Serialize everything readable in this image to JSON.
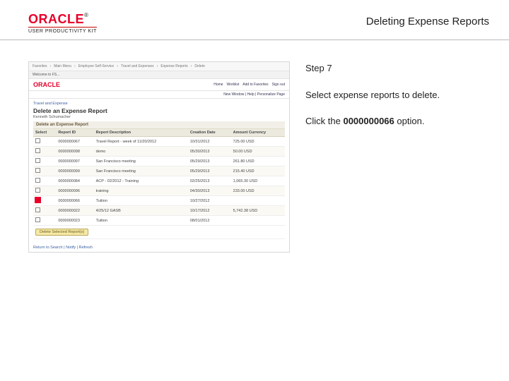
{
  "header": {
    "brand": "ORACLE",
    "tm": "®",
    "subbrand": "USER PRODUCTIVITY KIT",
    "doc_title": "Deleting Expense Reports"
  },
  "instructions": {
    "step_label": "Step 7",
    "line1": "Select expense reports to delete.",
    "line2a": "Click the ",
    "line2_bold": "0000000066",
    "line2b": " option."
  },
  "app": {
    "browser_tabs": [
      "Favorites",
      "Main Menu",
      "Employee Self-Service",
      "Travel and Expenses",
      "Expense Reports",
      "Delete"
    ],
    "tab_indicator": "Welcome to FS...",
    "brand": "ORACLE",
    "topnav": [
      "Home",
      "Worklist",
      "Add to Favorites",
      "Sign out"
    ],
    "userline": "New Window | Help | Personalize Page",
    "crumb": "Travel and Expense",
    "page_title": "Delete an Expense Report",
    "page_sub": "Kenneth Schumacher",
    "section": "Delete an Expense Report",
    "columns": [
      "Select",
      "Report ID",
      "Report Description",
      "Creation Date",
      "Amount Currency"
    ],
    "rows": [
      {
        "id": "0000000067",
        "desc": "Travel Report - week of 11/20/2012",
        "date": "10/31/2012",
        "amt": "725.00 USD"
      },
      {
        "id": "0000000098",
        "desc": "demo",
        "date": "05/30/2013",
        "amt": "50.00 USD"
      },
      {
        "id": "0000000097",
        "desc": "San Francisco meeting",
        "date": "05/29/2013",
        "amt": "261.80 USD"
      },
      {
        "id": "0000000099",
        "desc": "San Francisco meeting",
        "date": "05/29/2013",
        "amt": "215.40 USD"
      },
      {
        "id": "0000000084",
        "desc": "ACP - 02/2012 - Training",
        "date": "02/25/2013",
        "amt": "1,065.30 USD"
      },
      {
        "id": "0000000096",
        "desc": "training",
        "date": "04/30/2013",
        "amt": "233.00 USD"
      },
      {
        "id": "0000000066",
        "desc": "Tuition",
        "date": "10/27/2012",
        "amt": ""
      },
      {
        "id": "0000000022",
        "desc": "4/25/12 GASB",
        "date": "10/17/2012",
        "amt": "5,742.38 USD"
      },
      {
        "id": "0000000023",
        "desc": "Tuition",
        "date": "08/01/2012",
        "amt": ""
      }
    ],
    "highlight_id": "0000000066",
    "go_label": "Delete Selected Report(s)",
    "footer": "Return to Search | Notify | Refresh"
  }
}
